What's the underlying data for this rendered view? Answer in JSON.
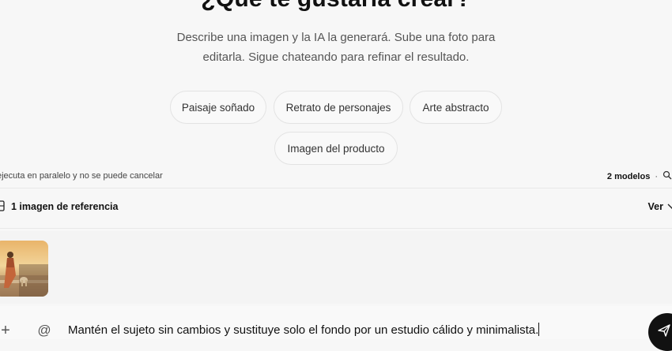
{
  "hero": {
    "title": "¿Qué te gustaría crear?",
    "subtitle_line1": "Describe una imagen y la IA la generará. Sube una foto para",
    "subtitle_line2": "editarla. Sigue chateando para refinar el resultado."
  },
  "suggestions": [
    {
      "label": "Paisaje soñado"
    },
    {
      "label": "Retrato de personajes"
    },
    {
      "label": "Arte abstracto"
    },
    {
      "label": "Imagen del producto"
    }
  ],
  "status": {
    "note": "ejecuta en paralelo y no se puede cancelar",
    "models": "2 modelos",
    "separator": "·"
  },
  "reference": {
    "label": "1 imagen de referencia",
    "view": "Ver"
  },
  "composer": {
    "prompt": "Mantén el sujeto sin cambios y sustituye solo el fondo por un estudio cálido y minimalista.",
    "plus": "+",
    "at": "@"
  },
  "icons": {
    "reference": "image-stack-icon",
    "models": "model-icon",
    "view": "chevron-down-icon",
    "send": "send-icon"
  },
  "colors": {
    "background": "#f7f7f7",
    "send_button": "#111111"
  }
}
